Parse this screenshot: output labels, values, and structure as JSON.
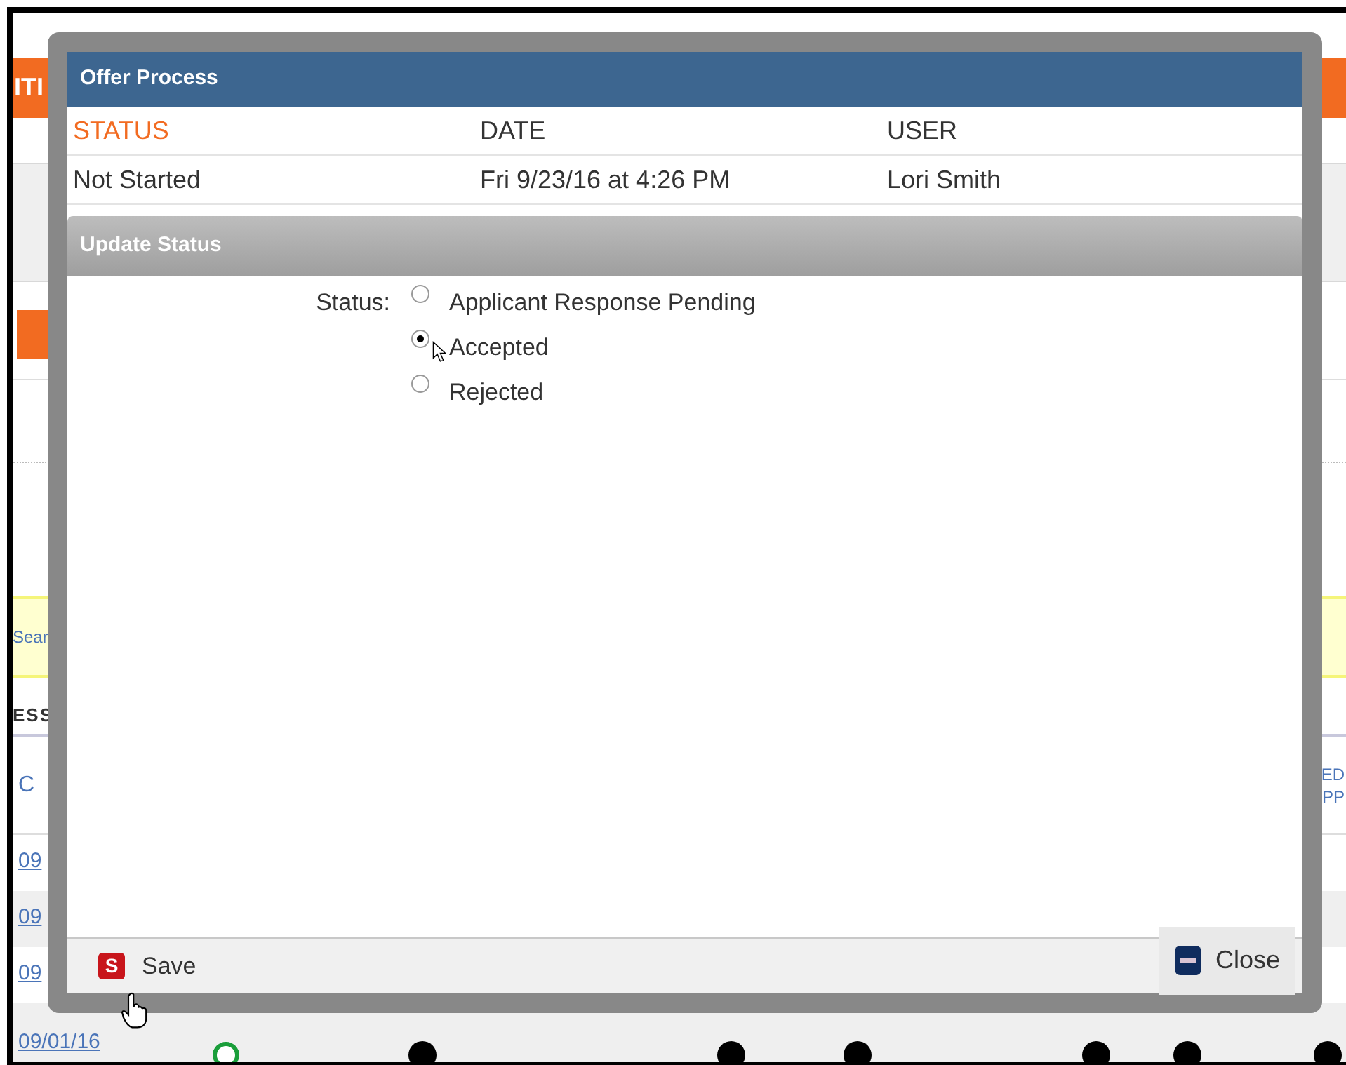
{
  "background_page": {
    "banner": "ITI",
    "search_link": "Sear",
    "section_heading": "ESS",
    "table": {
      "column_1": "C",
      "column_last": [
        "ED",
        "PP"
      ],
      "rows": [
        {
          "date": "09",
          "shaded": false
        },
        {
          "date": "09",
          "shaded": true
        },
        {
          "date": "09",
          "shaded": false
        },
        {
          "date": "09/01/16",
          "shaded": true
        }
      ]
    }
  },
  "dialog": {
    "title": "Offer Process",
    "history": {
      "columns": [
        {
          "label": "STATUS",
          "active": true
        },
        {
          "label": "DATE",
          "active": false
        },
        {
          "label": "USER",
          "active": false
        }
      ],
      "rows": [
        [
          "Not Started",
          "Fri 9/23/16 at 4:26 PM",
          "Lori Smith"
        ]
      ]
    },
    "update_panel": {
      "title": "Update Status",
      "field_label": "Status:",
      "options": [
        {
          "label": "Applicant Response Pending",
          "selected": false
        },
        {
          "label": "Accepted",
          "selected": true
        },
        {
          "label": "Rejected",
          "selected": false
        }
      ]
    },
    "buttons": [
      {
        "kind": "save",
        "icon_letter": "S",
        "label": "Save"
      },
      {
        "kind": "close",
        "label": "Close"
      }
    ]
  }
}
